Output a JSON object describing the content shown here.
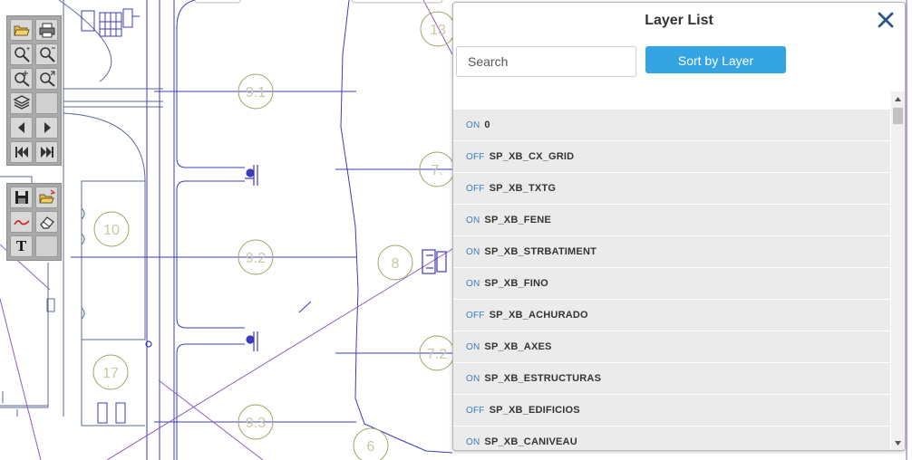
{
  "drawing": {
    "circle_labels": [
      "13",
      "9.1",
      "10",
      "9.2",
      "8",
      "17",
      "9.3",
      "6",
      "7.",
      "7.2"
    ],
    "colors": {
      "blue_line": "#3b3bbf",
      "purple_line": "#8e5cc4",
      "circle": "#c9c9a0",
      "grid_line": "#5a6a9a"
    }
  },
  "toolbar_main": {
    "buttons": [
      "open-folder-icon",
      "print-icon",
      "zoom-in-icon",
      "zoom-out-icon",
      "pan-zoom-icon",
      "zoom-extent-icon",
      "layers-icon",
      "blank",
      "arrow-left-icon",
      "arrow-right-icon",
      "first-page-icon",
      "last-page-icon"
    ]
  },
  "toolbar_markup": {
    "buttons": [
      "save-icon",
      "open-markup-icon",
      "freehand-icon",
      "eraser-icon",
      "text-tool",
      "blank"
    ],
    "text_tool_label": "T"
  },
  "layer_panel": {
    "title": "Layer List",
    "search_placeholder": "Search",
    "sort_label": "Sort by Layer",
    "layers": [
      {
        "state": "ON",
        "name": "0"
      },
      {
        "state": "OFF",
        "name": "SP_XB_CX_GRID"
      },
      {
        "state": "OFF",
        "name": "SP_XB_TXTG"
      },
      {
        "state": "ON",
        "name": "SP_XB_FENE"
      },
      {
        "state": "ON",
        "name": "SP_XB_STRBATIMENT"
      },
      {
        "state": "ON",
        "name": "SP_XB_FINO"
      },
      {
        "state": "OFF",
        "name": "SP_XB_ACHURADO"
      },
      {
        "state": "ON",
        "name": "SP_XB_AXES"
      },
      {
        "state": "ON",
        "name": "SP_XB_ESTRUCTURAS"
      },
      {
        "state": "OFF",
        "name": "SP_XB_EDIFICIOS"
      },
      {
        "state": "ON",
        "name": "SP_XB_CANIVEAU"
      }
    ],
    "accent": "#34a4e3",
    "state_color": "#3b7ec2"
  }
}
